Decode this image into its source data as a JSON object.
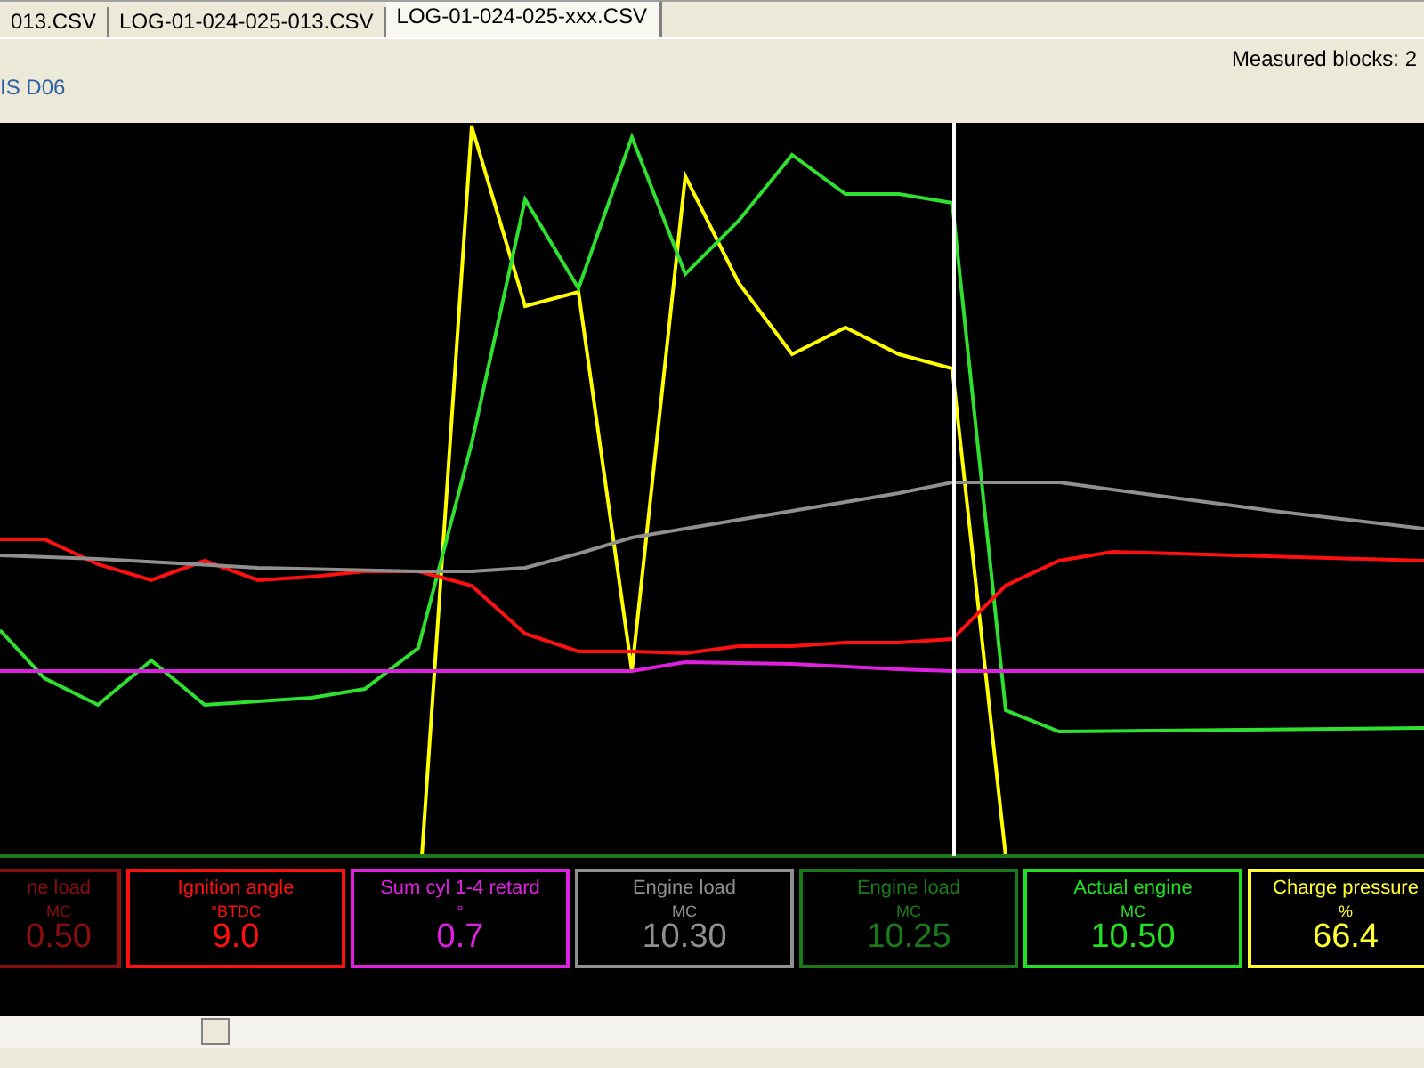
{
  "tabs": [
    {
      "label": "013.CSV",
      "selected": false
    },
    {
      "label": "LOG-01-024-025-013.CSV",
      "selected": false
    },
    {
      "label": "LOG-01-024-025-xxx.CSV",
      "selected": true
    }
  ],
  "info": {
    "module": "IS D06",
    "measured_blocks": "Measured blocks: 2"
  },
  "gauges": [
    {
      "label": "ne load",
      "unit": "MC",
      "value": "0.50",
      "color": "#8b0d0d"
    },
    {
      "label": "Ignition angle",
      "unit": "°BTDC",
      "value": "9.0",
      "color": "#ff1010"
    },
    {
      "label": "Sum cyl 1-4 retard",
      "unit": "°",
      "value": "0.7",
      "color": "#e020e0"
    },
    {
      "label": "Engine load",
      "unit": "MC",
      "value": "10.30",
      "color": "#909090"
    },
    {
      "label": "Engine load",
      "unit": "MC",
      "value": "10.25",
      "color": "#1a7a1a"
    },
    {
      "label": "Actual engine",
      "unit": "MC",
      "value": "10.50",
      "color": "#20e020"
    },
    {
      "label": "Charge pressure",
      "unit": "%",
      "value": "66.4",
      "color": "#ffff30"
    }
  ]
}
